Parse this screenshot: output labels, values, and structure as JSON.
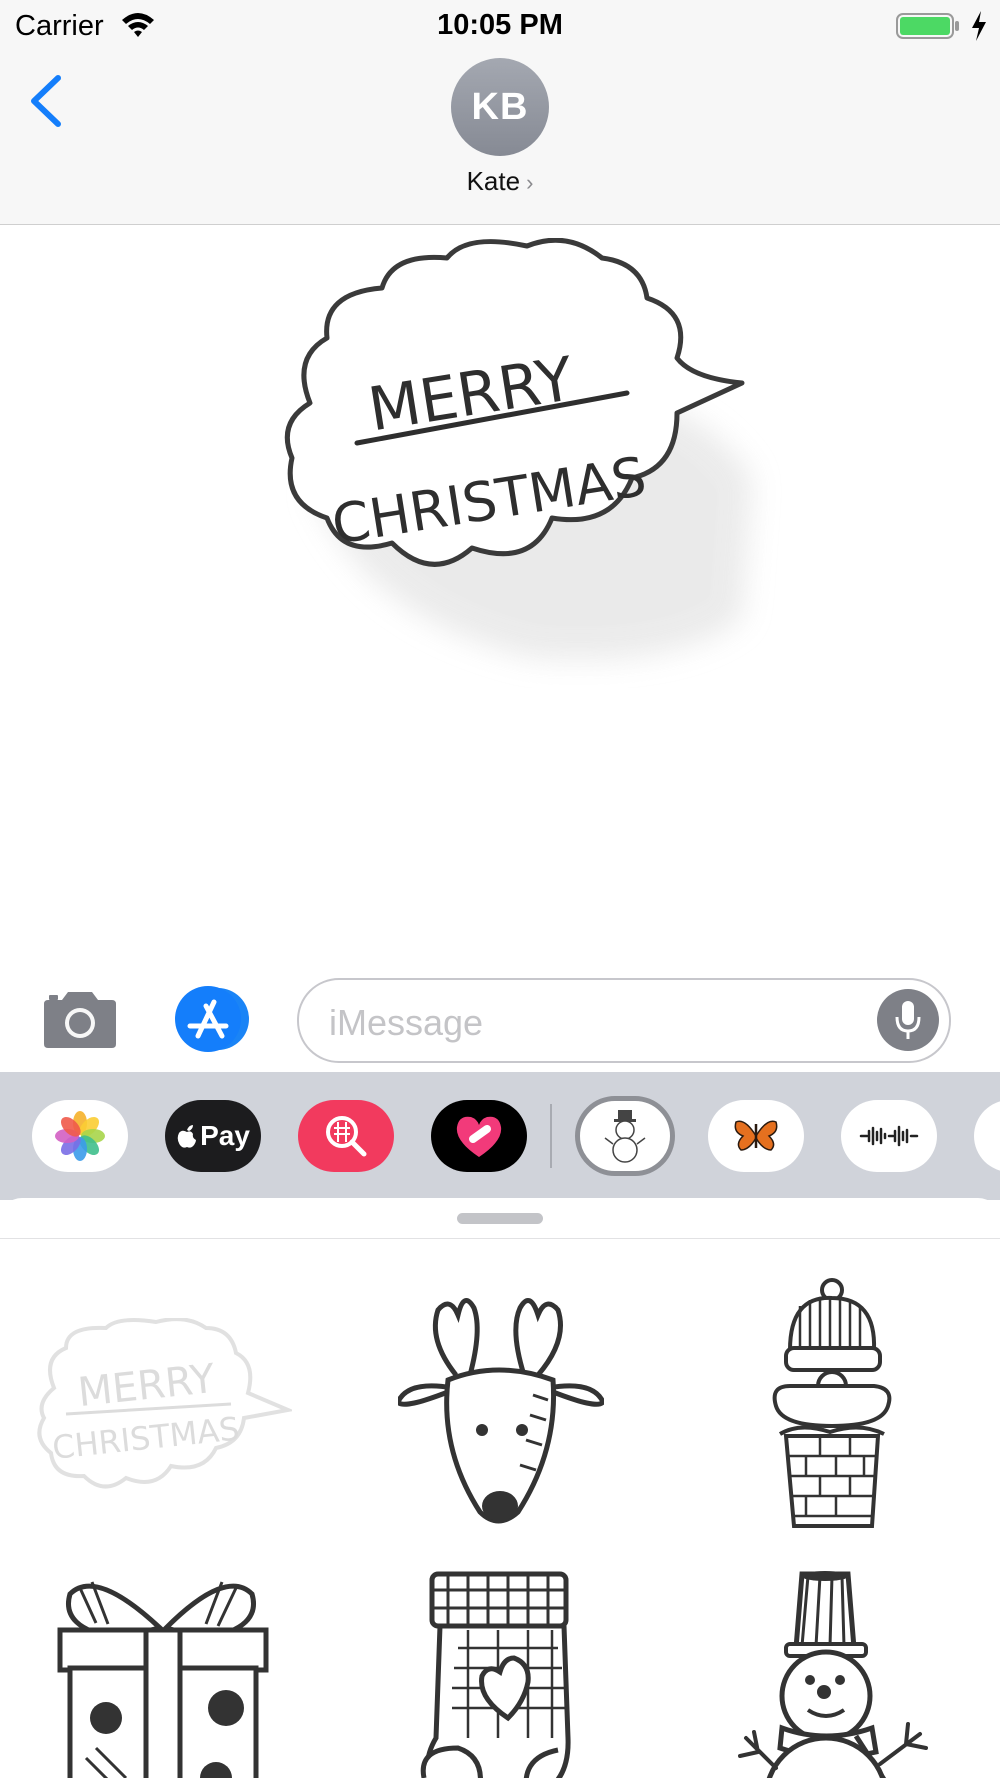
{
  "status_bar": {
    "carrier": "Carrier",
    "time": "10:05 PM",
    "battery_color": "#4cd964"
  },
  "header": {
    "back_icon": "chevron-left-icon",
    "avatar_initials": "KB",
    "contact_name": "Kate",
    "contact_chevron": "›",
    "accent_color": "#147efb"
  },
  "conversation": {
    "sticker": "merry-christmas-cloud-sticker",
    "sticker_text_line1": "MERRY",
    "sticker_text_line2": "CHRISTMAS"
  },
  "compose": {
    "camera_icon": "camera-icon",
    "appstore_icon": "app-store-icon",
    "placeholder": "iMessage",
    "mic_icon": "microphone-icon"
  },
  "app_drawer": {
    "apps": [
      {
        "name": "photos",
        "icon": "photos-icon"
      },
      {
        "name": "apple-pay",
        "label": "Pay",
        "icon": "apple-logo-icon"
      },
      {
        "name": "search-images",
        "icon": "image-search-icon"
      },
      {
        "name": "digital-touch",
        "icon": "heart-touch-icon"
      },
      {
        "name": "snowman-stickers",
        "icon": "snowman-icon",
        "selected": true
      },
      {
        "name": "butterfly-stickers",
        "icon": "butterfly-icon"
      },
      {
        "name": "audio-app",
        "icon": "waveform-icon"
      }
    ]
  },
  "sticker_panel": {
    "stickers": [
      {
        "name": "merry-christmas",
        "text_line1": "MERRY",
        "text_line2": "CHRISTMAS",
        "dimmed": true
      },
      {
        "name": "reindeer"
      },
      {
        "name": "santa-chimney"
      },
      {
        "name": "gift-box"
      },
      {
        "name": "christmas-stocking"
      },
      {
        "name": "snowman"
      }
    ]
  }
}
